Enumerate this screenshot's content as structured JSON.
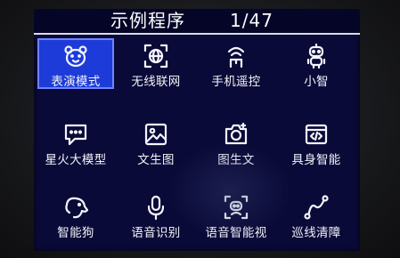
{
  "header": {
    "title": "示例程序",
    "page_indicator": "1/47"
  },
  "menu": {
    "items": [
      {
        "label": "表演模式",
        "icon": "bear-face-icon",
        "selected": true
      },
      {
        "label": "无线联网",
        "icon": "globe-network-icon",
        "selected": false
      },
      {
        "label": "手机遥控",
        "icon": "signal-antenna-icon",
        "selected": false
      },
      {
        "label": "小智",
        "icon": "robot-icon",
        "selected": false
      },
      {
        "label": "星火大模型",
        "icon": "chat-bubble-icon",
        "selected": false
      },
      {
        "label": "文生图",
        "icon": "picture-icon",
        "selected": false
      },
      {
        "label": "图生文",
        "icon": "camera-icon",
        "selected": false
      },
      {
        "label": "具身智能",
        "icon": "code-window-icon",
        "selected": false
      },
      {
        "label": "智能狗",
        "icon": "dog-icon",
        "selected": false
      },
      {
        "label": "语音识别",
        "icon": "microphone-icon",
        "selected": false
      },
      {
        "label": "语音智能视",
        "icon": "vision-assistant-icon",
        "selected": false
      },
      {
        "label": "巡线清障",
        "icon": "line-path-icon",
        "selected": false
      }
    ]
  },
  "colors": {
    "screen_background": "#0a0a38",
    "selected_tile": "#1d3bd8",
    "text": "#f2f2f8"
  }
}
